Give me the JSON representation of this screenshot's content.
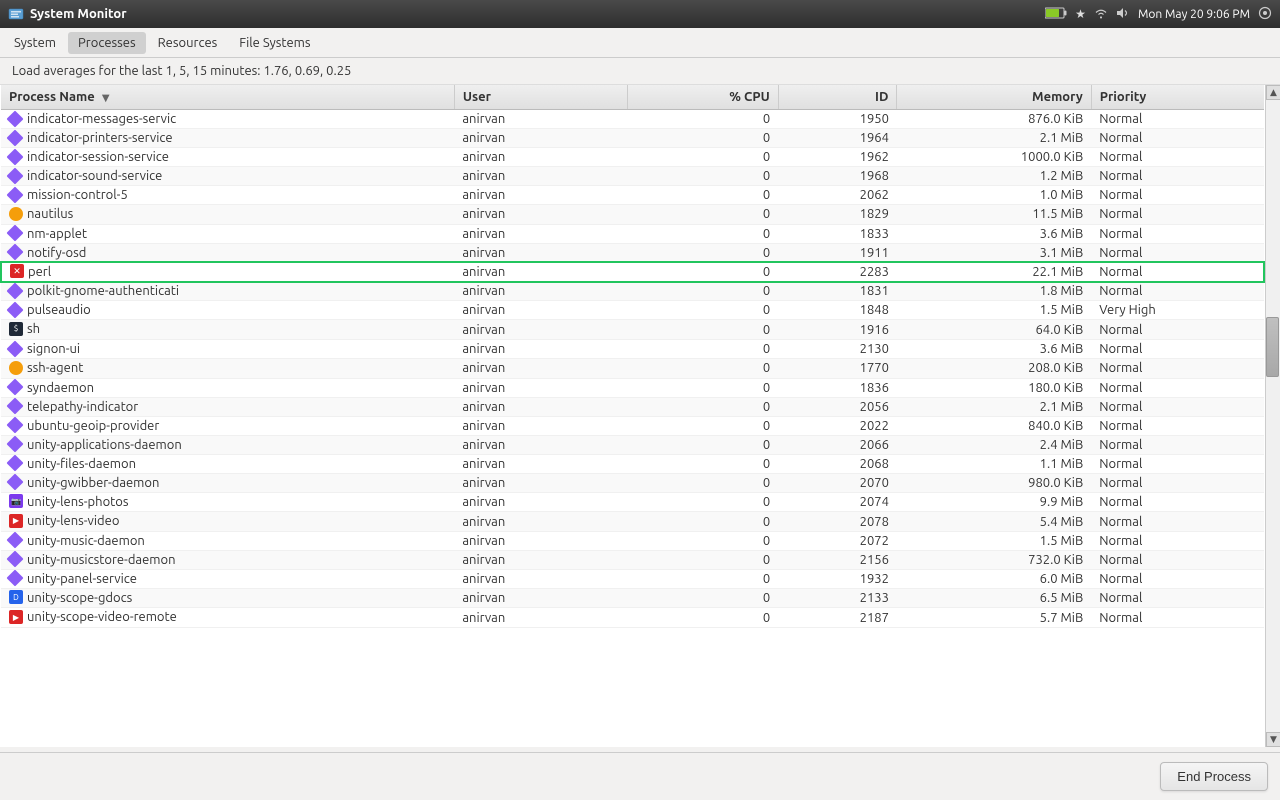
{
  "titlebar": {
    "title": "System Monitor",
    "time": "Mon May 20  9:06 PM"
  },
  "tabs": {
    "system_label": "System",
    "processes_label": "Processes",
    "resources_label": "Resources",
    "file_systems_label": "File Systems",
    "active": "Processes"
  },
  "load_avg": {
    "text": "Load averages for the last 1, 5, 15 minutes: 1.76, 0.69, 0.25"
  },
  "table": {
    "headers": {
      "process_name": "Process Name",
      "user": "User",
      "cpu": "% CPU",
      "id": "ID",
      "memory": "Memory",
      "priority": "Priority"
    },
    "processes": [
      {
        "icon": "diamond-purple",
        "name": "indicator-messages-servic",
        "user": "anirvan",
        "cpu": "0",
        "id": "1950",
        "memory": "876.0 KiB",
        "priority": "Normal"
      },
      {
        "icon": "diamond-purple",
        "name": "indicator-printers-service",
        "user": "anirvan",
        "cpu": "0",
        "id": "1964",
        "memory": "2.1 MiB",
        "priority": "Normal"
      },
      {
        "icon": "diamond-purple",
        "name": "indicator-session-service",
        "user": "anirvan",
        "cpu": "0",
        "id": "1962",
        "memory": "1000.0 KiB",
        "priority": "Normal"
      },
      {
        "icon": "diamond-purple",
        "name": "indicator-sound-service",
        "user": "anirvan",
        "cpu": "0",
        "id": "1968",
        "memory": "1.2 MiB",
        "priority": "Normal"
      },
      {
        "icon": "diamond-purple",
        "name": "mission-control-5",
        "user": "anirvan",
        "cpu": "0",
        "id": "2062",
        "memory": "1.0 MiB",
        "priority": "Normal"
      },
      {
        "icon": "nautilus",
        "name": "nautilus",
        "user": "anirvan",
        "cpu": "0",
        "id": "1829",
        "memory": "11.5 MiB",
        "priority": "Normal"
      },
      {
        "icon": "diamond-purple",
        "name": "nm-applet",
        "user": "anirvan",
        "cpu": "0",
        "id": "1833",
        "memory": "3.6 MiB",
        "priority": "Normal"
      },
      {
        "icon": "diamond-purple",
        "name": "notify-osd",
        "user": "anirvan",
        "cpu": "0",
        "id": "1911",
        "memory": "3.1 MiB",
        "priority": "Normal"
      },
      {
        "icon": "x-red",
        "name": "perl",
        "user": "anirvan",
        "cpu": "0",
        "id": "2283",
        "memory": "22.1 MiB",
        "priority": "Normal",
        "selected": true
      },
      {
        "icon": "diamond-purple",
        "name": "polkit-gnome-authenticati",
        "user": "anirvan",
        "cpu": "0",
        "id": "1831",
        "memory": "1.8 MiB",
        "priority": "Normal"
      },
      {
        "icon": "diamond-purple",
        "name": "pulseaudio",
        "user": "anirvan",
        "cpu": "0",
        "id": "1848",
        "memory": "1.5 MiB",
        "priority": "Very High"
      },
      {
        "icon": "terminal",
        "name": "sh",
        "user": "anirvan",
        "cpu": "0",
        "id": "1916",
        "memory": "64.0 KiB",
        "priority": "Normal"
      },
      {
        "icon": "diamond-purple",
        "name": "signon-ui",
        "user": "anirvan",
        "cpu": "0",
        "id": "2130",
        "memory": "3.6 MiB",
        "priority": "Normal"
      },
      {
        "icon": "yellow-circle",
        "name": "ssh-agent",
        "user": "anirvan",
        "cpu": "0",
        "id": "1770",
        "memory": "208.0 KiB",
        "priority": "Normal"
      },
      {
        "icon": "diamond-purple",
        "name": "syndaemon",
        "user": "anirvan",
        "cpu": "0",
        "id": "1836",
        "memory": "180.0 KiB",
        "priority": "Normal"
      },
      {
        "icon": "diamond-purple",
        "name": "telepathy-indicator",
        "user": "anirvan",
        "cpu": "0",
        "id": "2056",
        "memory": "2.1 MiB",
        "priority": "Normal"
      },
      {
        "icon": "diamond-purple",
        "name": "ubuntu-geoip-provider",
        "user": "anirvan",
        "cpu": "0",
        "id": "2022",
        "memory": "840.0 KiB",
        "priority": "Normal"
      },
      {
        "icon": "diamond-purple",
        "name": "unity-applications-daemon",
        "user": "anirvan",
        "cpu": "0",
        "id": "2066",
        "memory": "2.4 MiB",
        "priority": "Normal"
      },
      {
        "icon": "diamond-purple",
        "name": "unity-files-daemon",
        "user": "anirvan",
        "cpu": "0",
        "id": "2068",
        "memory": "1.1 MiB",
        "priority": "Normal"
      },
      {
        "icon": "diamond-purple",
        "name": "unity-gwibber-daemon",
        "user": "anirvan",
        "cpu": "0",
        "id": "2070",
        "memory": "980.0 KiB",
        "priority": "Normal"
      },
      {
        "icon": "photo",
        "name": "unity-lens-photos",
        "user": "anirvan",
        "cpu": "0",
        "id": "2074",
        "memory": "9.9 MiB",
        "priority": "Normal"
      },
      {
        "icon": "video",
        "name": "unity-lens-video",
        "user": "anirvan",
        "cpu": "0",
        "id": "2078",
        "memory": "5.4 MiB",
        "priority": "Normal"
      },
      {
        "icon": "diamond-purple",
        "name": "unity-music-daemon",
        "user": "anirvan",
        "cpu": "0",
        "id": "2072",
        "memory": "1.5 MiB",
        "priority": "Normal"
      },
      {
        "icon": "diamond-purple",
        "name": "unity-musicstore-daemon",
        "user": "anirvan",
        "cpu": "0",
        "id": "2156",
        "memory": "732.0 KiB",
        "priority": "Normal"
      },
      {
        "icon": "diamond-purple",
        "name": "unity-panel-service",
        "user": "anirvan",
        "cpu": "0",
        "id": "1932",
        "memory": "6.0 MiB",
        "priority": "Normal"
      },
      {
        "icon": "docs",
        "name": "unity-scope-gdocs",
        "user": "anirvan",
        "cpu": "0",
        "id": "2133",
        "memory": "6.5 MiB",
        "priority": "Normal"
      },
      {
        "icon": "video",
        "name": "unity-scope-video-remote",
        "user": "anirvan",
        "cpu": "0",
        "id": "2187",
        "memory": "5.7 MiB",
        "priority": "Normal"
      }
    ]
  },
  "buttons": {
    "end_process": "End Process"
  }
}
